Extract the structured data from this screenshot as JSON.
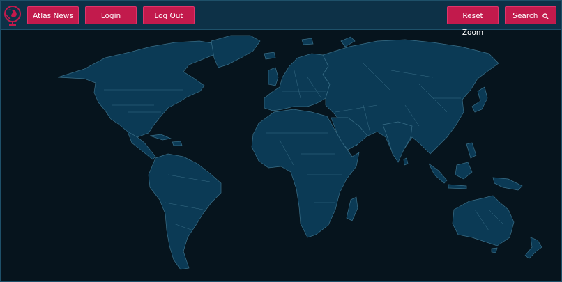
{
  "header": {
    "buttons": {
      "atlas_news": "Atlas News",
      "login": "Login",
      "log_out": "Log Out",
      "reset_zoom": "Reset Zoom",
      "search": "Search"
    },
    "search_icon": "magnifier-icon",
    "logo_icon": "globe-logo-icon"
  },
  "map": {
    "type": "world-choropleth",
    "country_borders": true,
    "zoom": "default"
  },
  "colors": {
    "page_background": "#06141d",
    "header_background": "#0d3147",
    "button": "#c21a4c",
    "land": "#0b3a55",
    "border": "#3a6f88"
  }
}
